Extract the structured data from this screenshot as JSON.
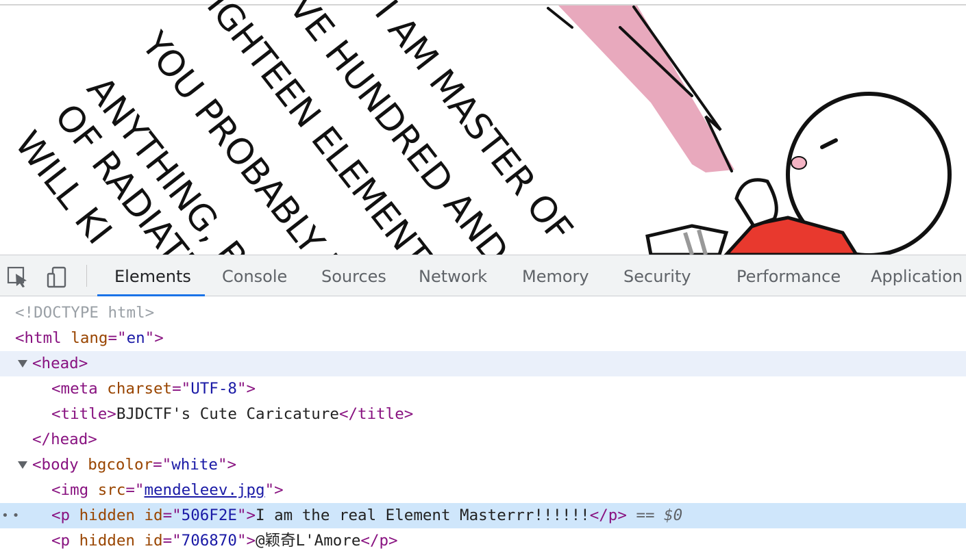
{
  "comic": {
    "lines": [
      "I AM MASTER OF",
      "VE HUNDRED AND",
      "IGHTEEN ELEMENT",
      "YOU PROBABLY DID",
      "ANYTHING, BU",
      "OF RADIATI",
      "WILL KI"
    ]
  },
  "toolbar": {
    "inspect_icon": "inspect-element-icon",
    "device_icon": "device-toolbar-icon",
    "tabs": [
      "Elements",
      "Console",
      "Sources",
      "Network",
      "Memory",
      "Security",
      "Performance",
      "Application"
    ],
    "active_tab": "Elements",
    "accent": "#1a73e8"
  },
  "tree": {
    "doctype": "<!DOCTYPE html>",
    "html_tag": "html",
    "html_attr": "lang",
    "html_val": "en",
    "head_tag": "head",
    "meta_tag": "meta",
    "meta_attr": "charset",
    "meta_val": "UTF-8",
    "title_tag": "title",
    "title_text": "BJDCTF's Cute Caricature",
    "body_tag": "body",
    "body_attr": "bgcolor",
    "body_val": "white",
    "img_tag": "img",
    "img_attr": "src",
    "img_val": "mendeleev.jpg",
    "p1_tag": "p",
    "p1_flag": "hidden",
    "p1_attr": "id",
    "p1_val": "506F2E",
    "p1_text": "I am the real Element Masterrr!!!!!!",
    "selected_marker": "== $0",
    "p2_tag": "p",
    "p2_flag": "hidden",
    "p2_attr": "id",
    "p2_val": "706870",
    "p2_text": "@颖奇L'Amore"
  }
}
